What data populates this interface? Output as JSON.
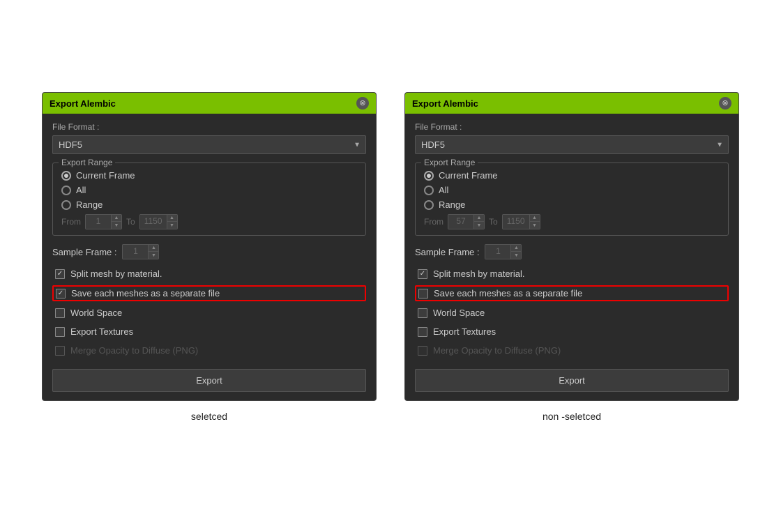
{
  "page": {
    "background": "#ffffff"
  },
  "left_panel": {
    "label": "seletced",
    "dialog": {
      "title": "Export Alembic",
      "file_format_label": "File Format :",
      "file_format_value": "HDF5",
      "export_range_legend": "Export Range",
      "radio_current_frame": "Current Frame",
      "radio_all": "All",
      "radio_range": "Range",
      "range_from_label": "From",
      "range_from_value": "1",
      "range_to_label": "To",
      "range_to_value": "1150",
      "sample_frame_label": "Sample Frame :",
      "sample_frame_value": "1",
      "split_mesh_label": "Split mesh by material.",
      "save_each_mesh_label": "Save each meshes as a separate file",
      "save_each_checked": true,
      "world_space_label": "World Space",
      "export_textures_label": "Export Textures",
      "merge_opacity_label": "Merge Opacity to Diffuse (PNG)",
      "export_btn_label": "Export"
    }
  },
  "right_panel": {
    "label": "non -seletced",
    "dialog": {
      "title": "Export Alembic",
      "file_format_label": "File Format :",
      "file_format_value": "HDF5",
      "export_range_legend": "Export Range",
      "radio_current_frame": "Current Frame",
      "radio_all": "All",
      "radio_range": "Range",
      "range_from_label": "From",
      "range_from_value": "57",
      "range_to_label": "To",
      "range_to_value": "1150",
      "sample_frame_label": "Sample Frame :",
      "sample_frame_value": "1",
      "split_mesh_label": "Split mesh by material.",
      "save_each_mesh_label": "Save each meshes as a separate file",
      "save_each_checked": false,
      "world_space_label": "World Space",
      "export_textures_label": "Export Textures",
      "merge_opacity_label": "Merge Opacity to Diffuse (PNG)",
      "export_btn_label": "Export"
    }
  }
}
